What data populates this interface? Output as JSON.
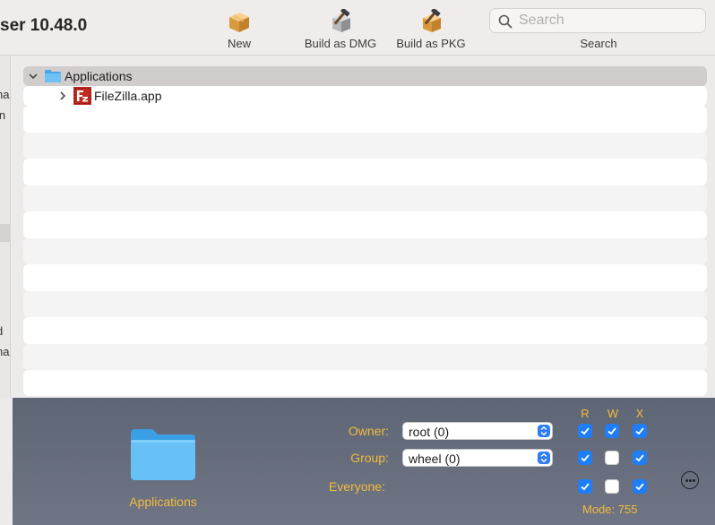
{
  "window": {
    "title_fragment": "ser 10.48.0"
  },
  "toolbar": {
    "buttons": [
      {
        "label": "New",
        "icon": "box-icon"
      },
      {
        "label": "Build as DMG",
        "icon": "hammer-box-icon"
      },
      {
        "label": "Build as PKG",
        "icon": "hammer-box-icon"
      }
    ],
    "search": {
      "placeholder": "Search",
      "value": "",
      "label": "Search",
      "icon": "magnifier-icon"
    }
  },
  "sidebar": {
    "fragments": [
      "na",
      "in",
      "d",
      "na"
    ]
  },
  "file_tree": {
    "items": [
      {
        "name": "Applications",
        "icon": "folder-icon",
        "expanded": true,
        "selected": true,
        "depth": 0
      },
      {
        "name": "FileZilla.app",
        "icon": "filezilla-icon",
        "expanded": false,
        "selected": false,
        "depth": 1
      }
    ]
  },
  "info_panel": {
    "folder_name": "Applications",
    "column_headers": [
      "R",
      "W",
      "X"
    ],
    "owner": {
      "label": "Owner:",
      "value": "root (0)",
      "R": true,
      "W": true,
      "X": true
    },
    "group": {
      "label": "Group:",
      "value": "wheel (0)",
      "R": true,
      "W": false,
      "X": true
    },
    "everyone": {
      "label": "Everyone:",
      "R": true,
      "W": false,
      "X": true
    },
    "mode": "Mode: 755",
    "more_icon": "ellipsis-circle-icon"
  },
  "colors": {
    "accent": "#1f7ef6",
    "label_gold": "#f2bc3c",
    "panel_bg": "#666c7b",
    "selected_row": "#d1cdcc"
  }
}
